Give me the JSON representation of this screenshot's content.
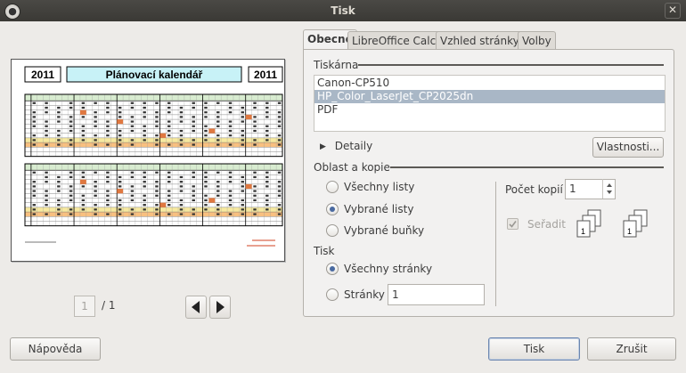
{
  "window": {
    "title": "Tisk"
  },
  "preview": {
    "title": "Plánovací kalendář",
    "year_left": "2011",
    "year_right": "2011",
    "page_current": "1",
    "page_total": "/ 1"
  },
  "tabs": [
    "Obecné",
    "LibreOffice Calc",
    "Vzhled stránky",
    "Volby"
  ],
  "printer": {
    "section_label": "Tiskárna",
    "items": [
      "Canon-CP510",
      "HP_Color_LaserJet_CP2025dn",
      "PDF"
    ],
    "selected_index": 1,
    "details_label": "Detaily",
    "properties_label": "Vlastnosti..."
  },
  "range": {
    "section_label": "Oblast a kopie",
    "options": [
      "Všechny listy",
      "Vybrané listy",
      "Vybrané buňky"
    ],
    "selected_index": 1
  },
  "print": {
    "section_label": "Tisk",
    "options": [
      "Všechny stránky",
      "Stránky"
    ],
    "selected_index": 0,
    "pages_value": "1"
  },
  "copies": {
    "label": "Počet kopií",
    "value": "1",
    "collate_label": "Seřadit",
    "collate_checked": true,
    "collate_enabled": false
  },
  "buttons": {
    "help": "Nápověda",
    "print": "Tisk",
    "cancel": "Zrušit"
  }
}
